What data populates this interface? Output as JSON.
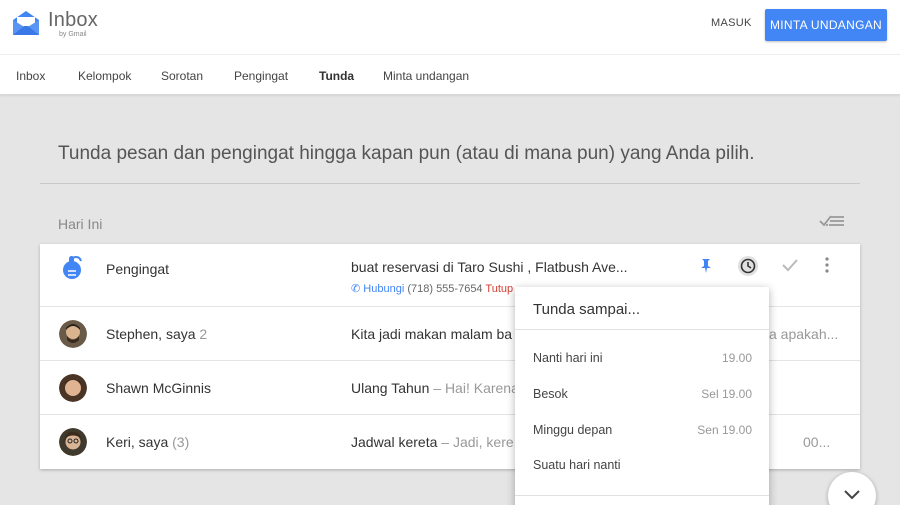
{
  "header": {
    "logo_text": "Inbox",
    "logo_sub": "by Gmail",
    "signin_label": "MASUK",
    "cta_label": "MINTA UNDANGAN"
  },
  "nav": {
    "items": [
      "Inbox",
      "Kelompok",
      "Sorotan",
      "Pengingat",
      "Tunda",
      "Minta undangan"
    ],
    "active": "Tunda"
  },
  "main": {
    "headline": "Tunda pesan dan pengingat hingga kapan pun (atau di mana pun) yang Anda pilih.",
    "section_title": "Hari Ini"
  },
  "rows": [
    {
      "sender": "Pengingat",
      "count": "",
      "subject": "buat reservasi di Taro Sushi , Flatbush Ave...",
      "snippet": "",
      "tail": "",
      "call_label": "Hubungi",
      "phone": "(718) 555-7654",
      "closed_label": "Tutup"
    },
    {
      "sender": "Stephen, saya",
      "count": "2",
      "subject": "Kita jadi makan malam ba",
      "snippet": "",
      "tail": "ya apakah..."
    },
    {
      "sender": "Shawn McGinnis",
      "count": "",
      "subject": "Ulang Tahun",
      "snippet": " – Hai! Karena",
      "tail": ""
    },
    {
      "sender": "Keri, saya",
      "count": "(3)",
      "subject": "Jadwal kereta",
      "snippet": " – Jadi, kere",
      "tail": "00..."
    }
  ],
  "snooze_menu": {
    "title": "Tunda sampai...",
    "options": [
      {
        "label": "Nanti hari ini",
        "time": "19.00"
      },
      {
        "label": "Besok",
        "time": "Sel 19.00"
      },
      {
        "label": "Minggu depan",
        "time": "Sen 19.00"
      },
      {
        "label": "Suatu hari nanti",
        "time": ""
      }
    ]
  },
  "colors": {
    "accent": "#4285f4",
    "warning": "#d23f31",
    "background": "#e5e5e5"
  }
}
